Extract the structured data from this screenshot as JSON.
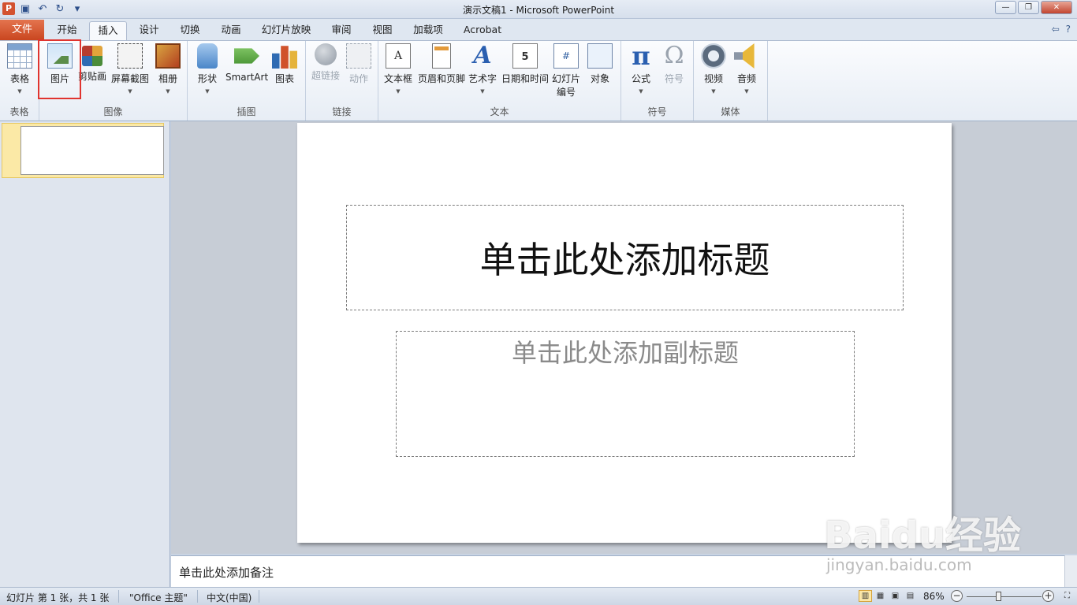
{
  "window": {
    "title": "演示文稿1  -  Microsoft PowerPoint",
    "app_icon": "P"
  },
  "tabs": {
    "file": "文件",
    "items": [
      "开始",
      "插入",
      "设计",
      "切换",
      "动画",
      "幻灯片放映",
      "审阅",
      "视图",
      "加载项",
      "Acrobat"
    ],
    "active": "插入"
  },
  "ribbon": {
    "groups": {
      "tables": "表格",
      "images": "图像",
      "illustrations": "插图",
      "links": "链接",
      "text": "文本",
      "symbols": "符号",
      "media": "媒体"
    },
    "buttons": {
      "table": "表格",
      "picture": "图片",
      "clipart": "剪贴画",
      "screenshot": "屏幕截图",
      "album": "相册",
      "shapes": "形状",
      "smartart": "SmartArt",
      "chart": "图表",
      "hyperlink": "超链接",
      "action": "动作",
      "textbox": "文本框",
      "header_footer": "页眉和页脚",
      "wordart": "艺术字",
      "datetime": "日期和时间",
      "slidenum_line1": "幻灯片",
      "slidenum_line2": "编号",
      "object": "对象",
      "equation": "公式",
      "symbol": "符号",
      "video": "视频",
      "audio": "音频"
    },
    "icon_glyphs": {
      "textbox": "A",
      "wordart": "A",
      "datetime": "5",
      "slidenum": "#",
      "equation": "π",
      "symbol": "Ω"
    }
  },
  "slide": {
    "title_placeholder": "单击此处添加标题",
    "subtitle_placeholder": "单击此处添加副标题"
  },
  "notes": {
    "placeholder": "单击此处添加备注"
  },
  "statusbar": {
    "slide_info": "幻灯片 第 1 张，共 1 张",
    "theme": "\"Office 主题\"",
    "language": "中文(中国)",
    "zoom": "86%",
    "zoom_level": 0.86
  },
  "watermark": {
    "brand": "Baidu经验",
    "url": "jingyan.baidu.com"
  },
  "colors": {
    "file_tab": "#d35230",
    "highlight": "#e0342f",
    "accent": "#2a5fb0"
  }
}
